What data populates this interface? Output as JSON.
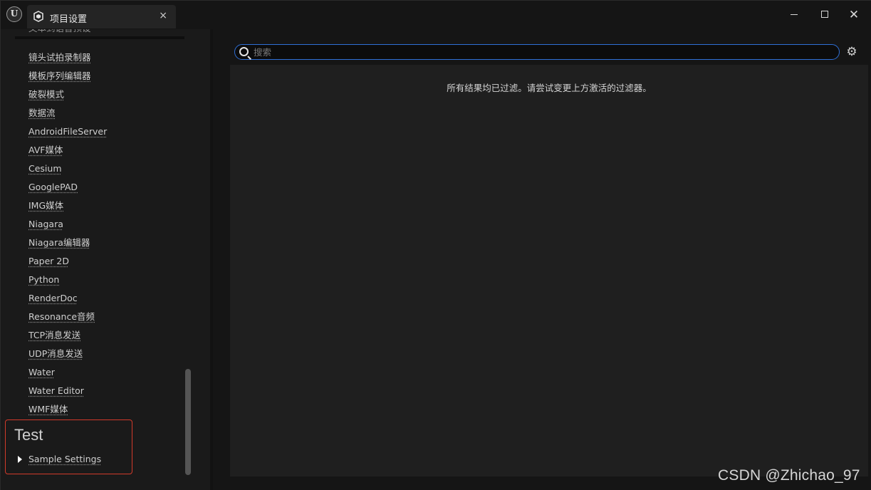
{
  "titlebar": {
    "tab_label": "项目设置",
    "tab_close": "×",
    "close_symbol": "✕"
  },
  "sidebar": {
    "cut_item": "文本到语音预设",
    "items": [
      "镜头试拍录制器",
      "模板序列编辑器",
      "破裂模式",
      "数据流",
      "AndroidFileServer",
      "AVF媒体",
      "Cesium",
      "GooglePAD",
      "IMG媒体",
      "Niagara",
      "Niagara编辑器",
      "Paper 2D",
      "Python",
      "RenderDoc",
      "Resonance音频",
      "TCP消息发送",
      "UDP消息发送",
      "Water",
      "Water Editor",
      "WMF媒体"
    ],
    "test_section": {
      "title": "Test",
      "item": "Sample Settings"
    }
  },
  "main": {
    "search": {
      "placeholder": "搜索",
      "value": ""
    },
    "empty_message": "所有结果均已过滤。请尝试变更上方激活的过滤器。"
  },
  "icons": {
    "app": "unreal-engine-logo",
    "tab": "project-settings-icon",
    "search": "search-icon",
    "settings": "gear-icon"
  },
  "colors": {
    "accent_search_border": "#2f6fd6",
    "highlight_box": "#d23a2a"
  },
  "watermark": "CSDN @Zhichao_97"
}
